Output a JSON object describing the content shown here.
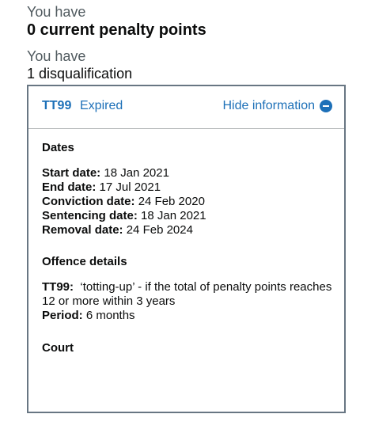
{
  "summary": {
    "points_label": "You have",
    "points_value": "0 current penalty points",
    "disq_label": "You have",
    "disq_value": "1 disqualification"
  },
  "offence": {
    "code": "TT99",
    "status": "Expired",
    "toggle_label": "Hide information",
    "dates_heading": "Dates",
    "dates": [
      {
        "label": "Start date:",
        "value": "18 Jan 2021"
      },
      {
        "label": "End date:",
        "value": "17 Jul 2021"
      },
      {
        "label": "Conviction date:",
        "value": "24 Feb 2020"
      },
      {
        "label": "Sentencing date:",
        "value": "18 Jan 2021"
      },
      {
        "label": "Removal date:",
        "value": "24 Feb 2024"
      }
    ],
    "details_heading": "Offence details",
    "detail_code_label": "TT99:",
    "detail_description": "‘totting-up’ - if the total of penalty points reaches 12 or more within 3 years",
    "period_label": "Period:",
    "period_value": "6 months",
    "court_heading": "Court"
  },
  "icons": {
    "toggle_icon": "minus-circle-icon"
  },
  "colors": {
    "link": "#1d70b8",
    "text": "#0b0c0c",
    "muted": "#505a5f",
    "border": "#687683"
  }
}
